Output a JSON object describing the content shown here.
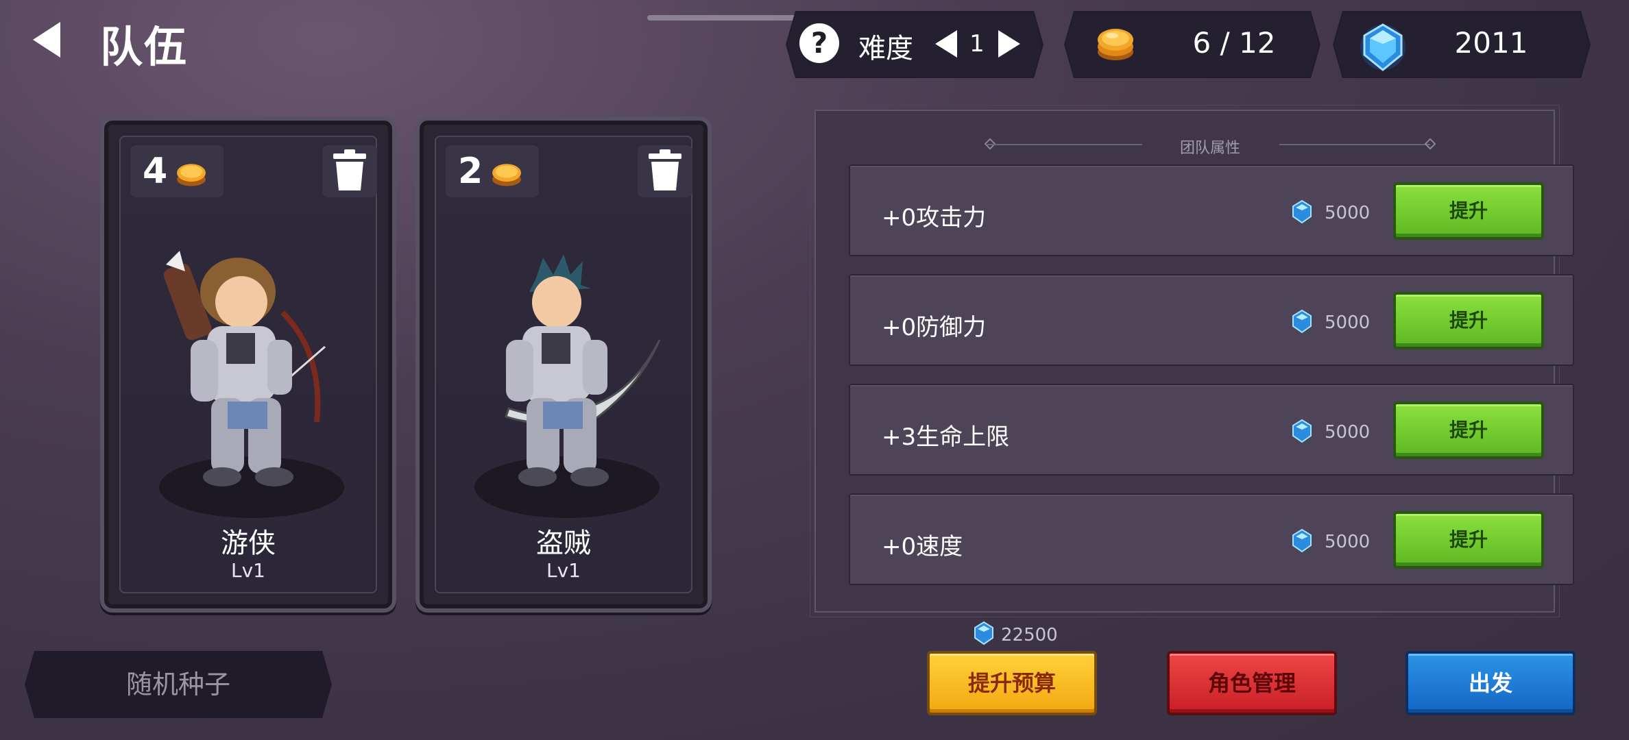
{
  "header": {
    "title": "队伍",
    "difficulty_label": "难度",
    "difficulty_value": "1",
    "coins": "6 / 12",
    "gems": "2011"
  },
  "cards": [
    {
      "cost": "4",
      "name": "游侠",
      "level": "Lv1"
    },
    {
      "cost": "2",
      "name": "盗贼",
      "level": "Lv1"
    }
  ],
  "team_attributes": {
    "title": "团队属性",
    "rows": [
      {
        "label": "+0攻击力",
        "cost": "5000",
        "button": "提升"
      },
      {
        "label": "+0防御力",
        "cost": "5000",
        "button": "提升"
      },
      {
        "label": "+3生命上限",
        "cost": "5000",
        "button": "提升"
      },
      {
        "label": "+0速度",
        "cost": "5000",
        "button": "提升"
      }
    ]
  },
  "footer": {
    "seed_button": "随机种子",
    "budget": "22500",
    "raise_budget_button": "提升预算",
    "character_management_button": "角色管理",
    "depart_button": "出发"
  },
  "colors": {
    "background": "#3d3346",
    "upgrade_green": "#6cc82b",
    "raise_yellow": "#f8c028",
    "manage_red": "#dc3035",
    "depart_blue": "#1f7fd6",
    "gem_blue": "#3fb6f5",
    "coin_gold": "#f5a623"
  },
  "icons": [
    "back-arrow-icon",
    "help-icon",
    "chevron-left-icon",
    "chevron-right-icon",
    "coin-icon",
    "gem-icon",
    "trash-icon"
  ]
}
